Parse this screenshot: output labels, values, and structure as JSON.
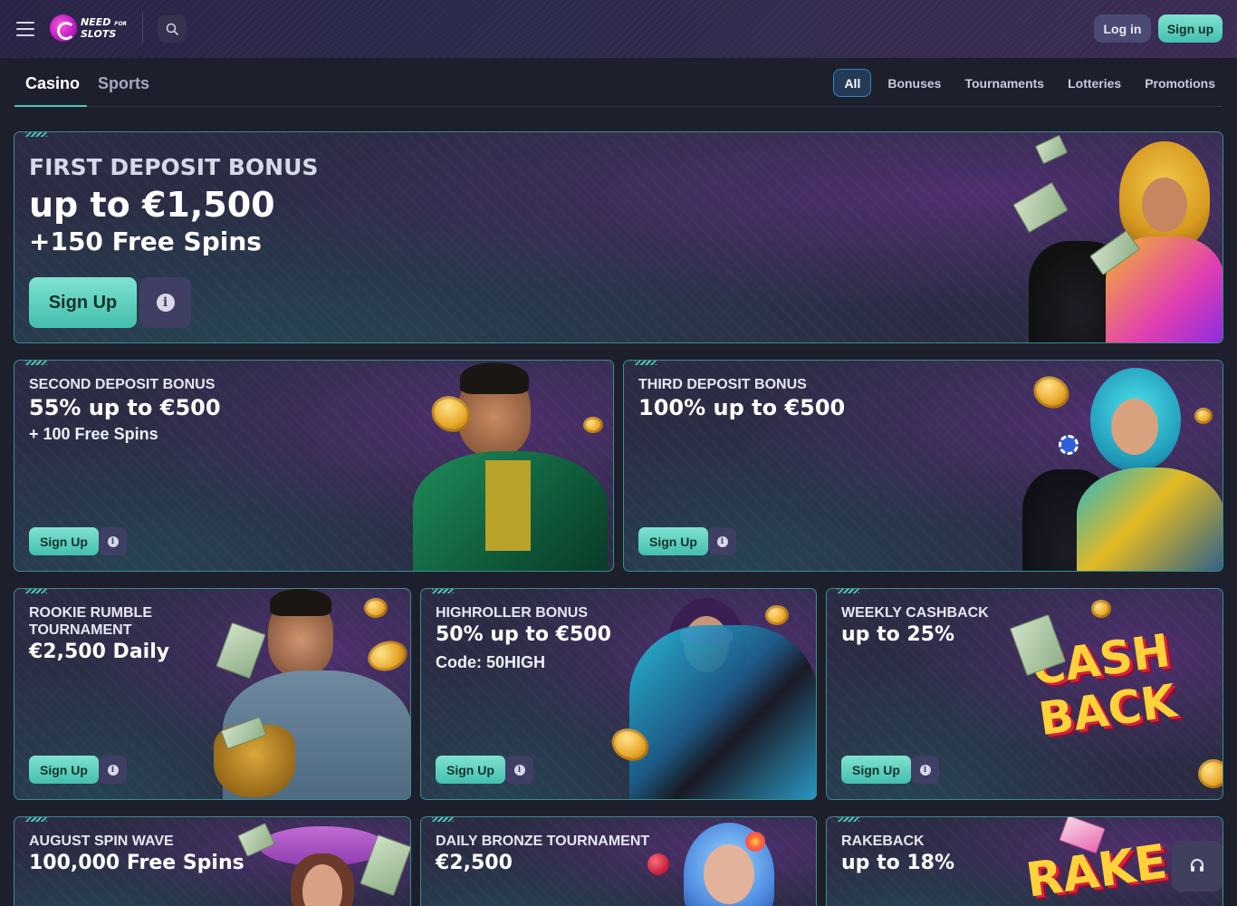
{
  "header": {
    "menu_icon": "menu-icon",
    "logo": {
      "line1": "NEED",
      "line2_small": "FOR",
      "line3": "SLOTS"
    },
    "search_icon": "search-icon",
    "login_label": "Log in",
    "signup_label": "Sign up"
  },
  "tabs": {
    "main": [
      {
        "label": "Casino",
        "active": true
      },
      {
        "label": "Sports",
        "active": false
      }
    ],
    "filters": [
      {
        "label": "All",
        "active": true
      },
      {
        "label": "Bonuses"
      },
      {
        "label": "Tournaments"
      },
      {
        "label": "Lotteries"
      },
      {
        "label": "Promotions"
      }
    ]
  },
  "promos": {
    "first": {
      "eyebrow": "FIRST DEPOSIT BONUS",
      "headline": "up to €1,500",
      "subline": "+150 Free Spins",
      "cta": "Sign Up"
    },
    "second": {
      "eyebrow": "SECOND DEPOSIT BONUS",
      "headline": "55% up to €500",
      "subline": "+ 100 Free Spins",
      "cta": "Sign Up"
    },
    "third": {
      "eyebrow": "THIRD DEPOSIT BONUS",
      "headline": "100% up to €500",
      "cta": "Sign Up"
    },
    "rookie": {
      "eyebrow_line1": "ROOKIE RUMBLE",
      "eyebrow_line2": "TOURNAMENT",
      "headline": "€2,500 Daily",
      "cta": "Sign Up"
    },
    "highroller": {
      "eyebrow": "HIGHROLLER BONUS",
      "headline": "50% up to €500",
      "subline": "Code: 50HIGH",
      "cta": "Sign Up"
    },
    "cashback": {
      "eyebrow": "WEEKLY CASHBACK",
      "headline": "up to 25%",
      "art_line1": "CASH",
      "art_line2": "BACK",
      "cta": "Sign Up"
    },
    "spinwave": {
      "eyebrow": "AUGUST SPIN WAVE",
      "headline": "100,000 Free Spins"
    },
    "bronze": {
      "eyebrow": "DAILY BRONZE TOURNAMENT",
      "headline": "€2,500"
    },
    "rakeback": {
      "eyebrow": "RAKEBACK",
      "headline": "up to 18%",
      "art_text": "RAKE"
    }
  },
  "support_icon": "headset-icon",
  "colors": {
    "accent_teal": "#4fc8b6",
    "border_teal": "#3a8d86",
    "bg": "#1d1f2d",
    "header_bg": "#2a2345"
  }
}
